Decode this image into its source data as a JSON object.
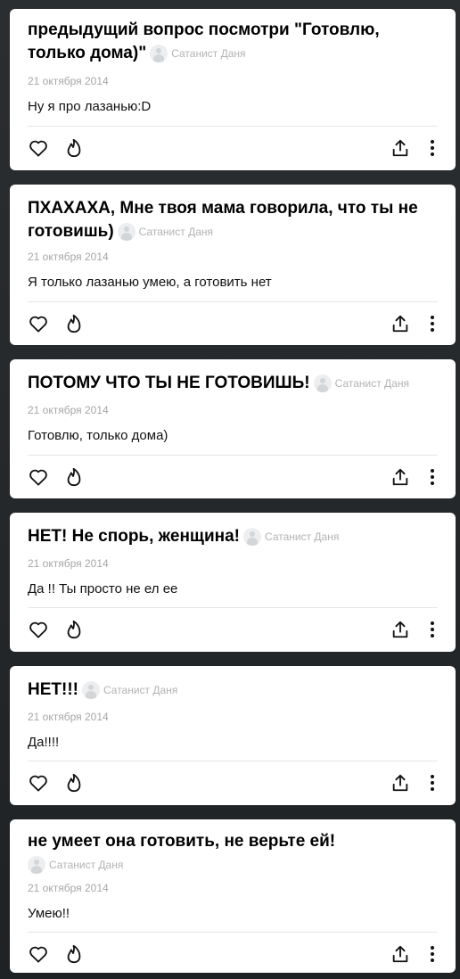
{
  "posts": [
    {
      "question": "предыдущий вопрос посмотри \"Готовлю, только дома)\"",
      "author": "Сатанист Даня",
      "date": "21 октября 2014",
      "answer": "Ну я про лазанью:D"
    },
    {
      "question": "ПХАХАХА, Мне твоя мама говорила, что ты не готовишь)",
      "author": "Сатанист Даня",
      "date": "21 октября 2014",
      "answer": "Я только лазанью умею, а готовить нет"
    },
    {
      "question": "ПОТОМУ ЧТО ТЫ НЕ ГОТОВИШЬ!",
      "author": "Сатанист Даня",
      "date": "21 октября 2014",
      "answer": "Готовлю, только дома)"
    },
    {
      "question": "НЕТ! Не спорь, женщина!",
      "author": "Сатанист Даня",
      "date": "21 октября 2014",
      "answer": "Да !! Ты просто не ел ее"
    },
    {
      "question": "НЕТ!!!",
      "author": "Сатанист Даня",
      "date": "21 октября 2014",
      "answer": "Да!!!!"
    },
    {
      "question": "не умеет она готовить, не верьте ей!",
      "author": "Сатанист Даня",
      "date": "21 октября 2014",
      "answer": "Умею!!"
    }
  ],
  "icons": {
    "like": "heart-icon",
    "fire": "fire-icon",
    "share": "share-icon",
    "more": "more-vertical-icon"
  },
  "colors": {
    "background": "#24272a",
    "card": "#ffffff",
    "meta": "#a7a7a7"
  }
}
